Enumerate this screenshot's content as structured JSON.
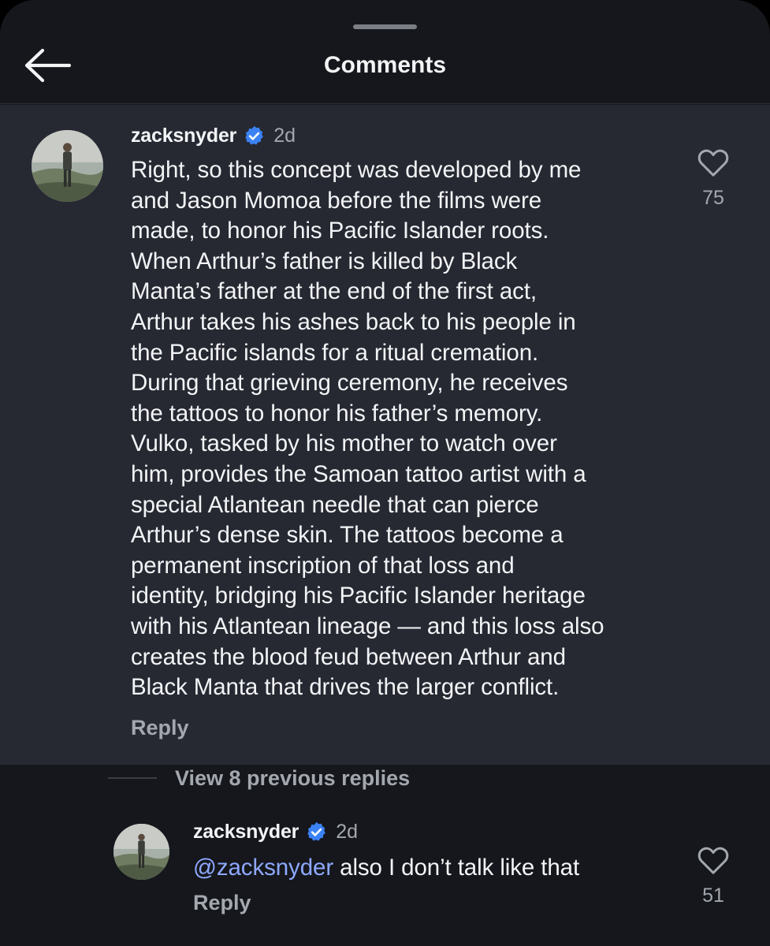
{
  "header": {
    "title": "Comments",
    "back_icon": "arrow-left-icon"
  },
  "main_comment": {
    "username": "zacksnyder",
    "verified": true,
    "time": "2d",
    "text": "Right, so this concept was developed by me\nand Jason Momoa before the films were\nmade, to honor his Pacific Islander roots.\nWhen Arthur’s father is killed by Black\nManta’s father at the end of the first act,\nArthur takes his ashes back to his people in\nthe Pacific islands for a ritual cremation.\nDuring that grieving ceremony, he receives\nthe tattoos to honor his father’s memory.\nVulko, tasked by his mother to watch over\nhim, provides the Samoan tattoo artist with a\nspecial Atlantean needle that can pierce\nArthur’s dense skin. The tattoos become a\npermanent inscription of that loss and\nidentity, bridging his Pacific Islander heritage\nwith his Atlantean lineage — and this loss also\ncreates the blood feud between Arthur and\nBlack Manta that drives the larger conflict.",
    "reply_label": "Reply",
    "likes": "75"
  },
  "view_replies_label": "View 8 previous replies",
  "reply_comment": {
    "username": "zacksnyder",
    "verified": true,
    "time": "2d",
    "mention": "@zacksnyder",
    "text": " also I don’t talk like that",
    "reply_label": "Reply",
    "likes": "51"
  },
  "colors": {
    "background": "#15171c",
    "highlight_background": "#262932",
    "verified_badge": "#3b82f6",
    "mention": "#8ea8ff",
    "muted_text": "#a3a7ae"
  },
  "icons": {
    "like": "heart-outline-icon",
    "verified": "verified-badge-icon"
  }
}
